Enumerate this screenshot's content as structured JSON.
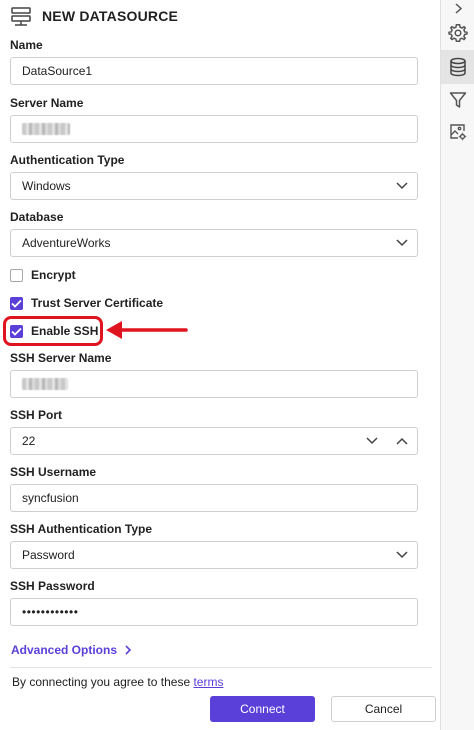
{
  "header": {
    "title": "NEW DATASOURCE",
    "icon": "server-icon"
  },
  "fields": {
    "name": {
      "label": "Name",
      "value": "DataSource1"
    },
    "server_name": {
      "label": "Server Name",
      "value": ""
    },
    "auth_type": {
      "label": "Authentication Type",
      "value": "Windows"
    },
    "database": {
      "label": "Database",
      "value": "AdventureWorks"
    },
    "ssh_server_name": {
      "label": "SSH Server Name",
      "value": ""
    },
    "ssh_port": {
      "label": "SSH Port",
      "value": "22"
    },
    "ssh_username": {
      "label": "SSH Username",
      "value": "syncfusion"
    },
    "ssh_auth_type": {
      "label": "SSH Authentication Type",
      "value": "Password"
    },
    "ssh_password": {
      "label": "SSH Password",
      "value": "••••••••••••"
    }
  },
  "checkboxes": {
    "encrypt": {
      "label": "Encrypt",
      "checked": false
    },
    "trust_cert": {
      "label": "Trust Server Certificate",
      "checked": true
    },
    "enable_ssh": {
      "label": "Enable SSH",
      "checked": true
    }
  },
  "advanced": {
    "label": "Advanced Options"
  },
  "terms": {
    "text": "By connecting you agree to these",
    "link": "terms"
  },
  "buttons": {
    "connect": "Connect",
    "cancel": "Cancel"
  },
  "rail": {
    "items": [
      "chevron-right-icon",
      "settings-icon",
      "database-icon",
      "filter-icon",
      "image-settings-icon"
    ],
    "active": "database-icon"
  },
  "colors": {
    "accent": "#5b3fd9",
    "annotation": "#e0141e"
  }
}
